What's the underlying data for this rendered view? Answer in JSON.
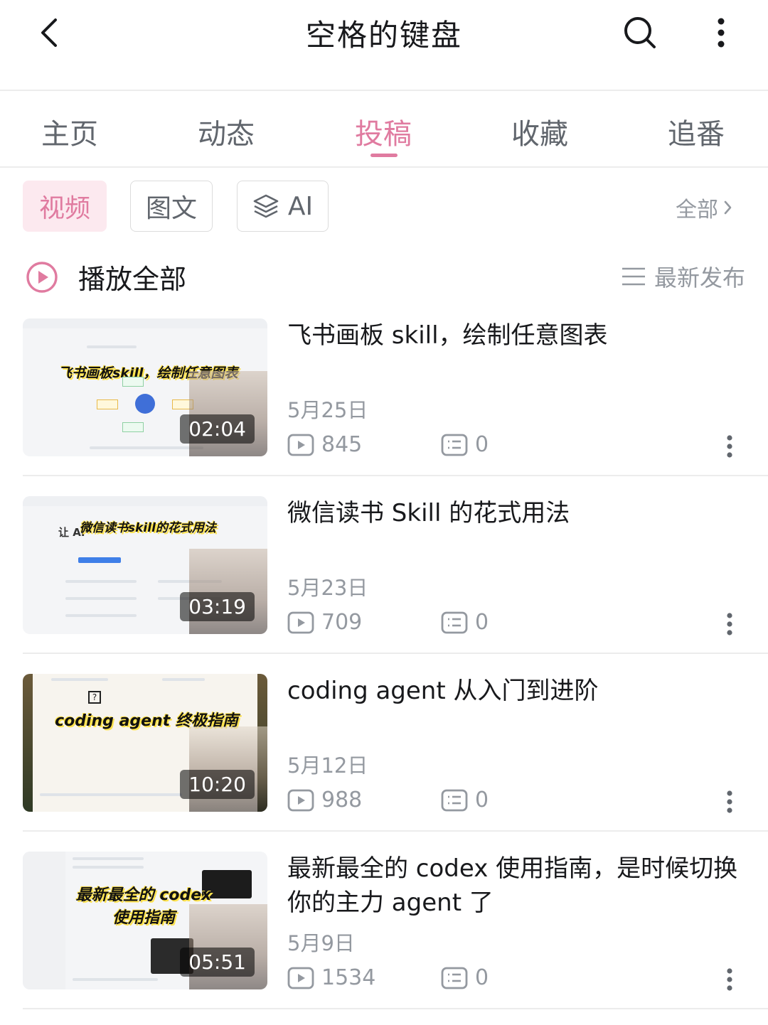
{
  "header": {
    "title": "空格的键盘",
    "back_icon": "chevron-left-icon",
    "search_icon": "search-icon",
    "more_icon": "more-vertical-icon"
  },
  "tabs": [
    {
      "label": "主页",
      "active": false
    },
    {
      "label": "动态",
      "active": false
    },
    {
      "label": "投稿",
      "active": true
    },
    {
      "label": "收藏",
      "active": false
    },
    {
      "label": "追番",
      "active": false
    }
  ],
  "filters": {
    "chips": [
      {
        "label": "视频",
        "active": true
      },
      {
        "label": "图文",
        "active": false
      },
      {
        "label": "AI",
        "active": false,
        "icon": "layers-icon"
      }
    ],
    "all_label": "全部"
  },
  "playall": {
    "label": "播放全部",
    "sort_label": "最新发布"
  },
  "videos": [
    {
      "title": "飞书画板 skill，绘制任意图表",
      "date": "5月25日",
      "views": "845",
      "comments": "0",
      "duration": "02:04",
      "thumb_caption": "飞书画板skill，绘制任意图表"
    },
    {
      "title": "微信读书 Skill 的花式用法",
      "date": "5月23日",
      "views": "709",
      "comments": "0",
      "duration": "03:19",
      "thumb_caption": "微信读书skill的花式用法"
    },
    {
      "title": "coding agent 从入门到进阶",
      "date": "5月12日",
      "views": "988",
      "comments": "0",
      "duration": "10:20",
      "thumb_caption": "coding agent 终极指南"
    },
    {
      "title": "最新最全的 codex 使用指南，是时候切换你的主力 agent 了",
      "date": "5月9日",
      "views": "1534",
      "comments": "0",
      "duration": "05:51",
      "thumb_caption": "最新最全的 codex 使用指南"
    }
  ],
  "colors": {
    "accent": "#e07ba0",
    "accent_bg": "#fce9ef",
    "text_primary": "#18191c",
    "text_secondary": "#9499a0"
  }
}
